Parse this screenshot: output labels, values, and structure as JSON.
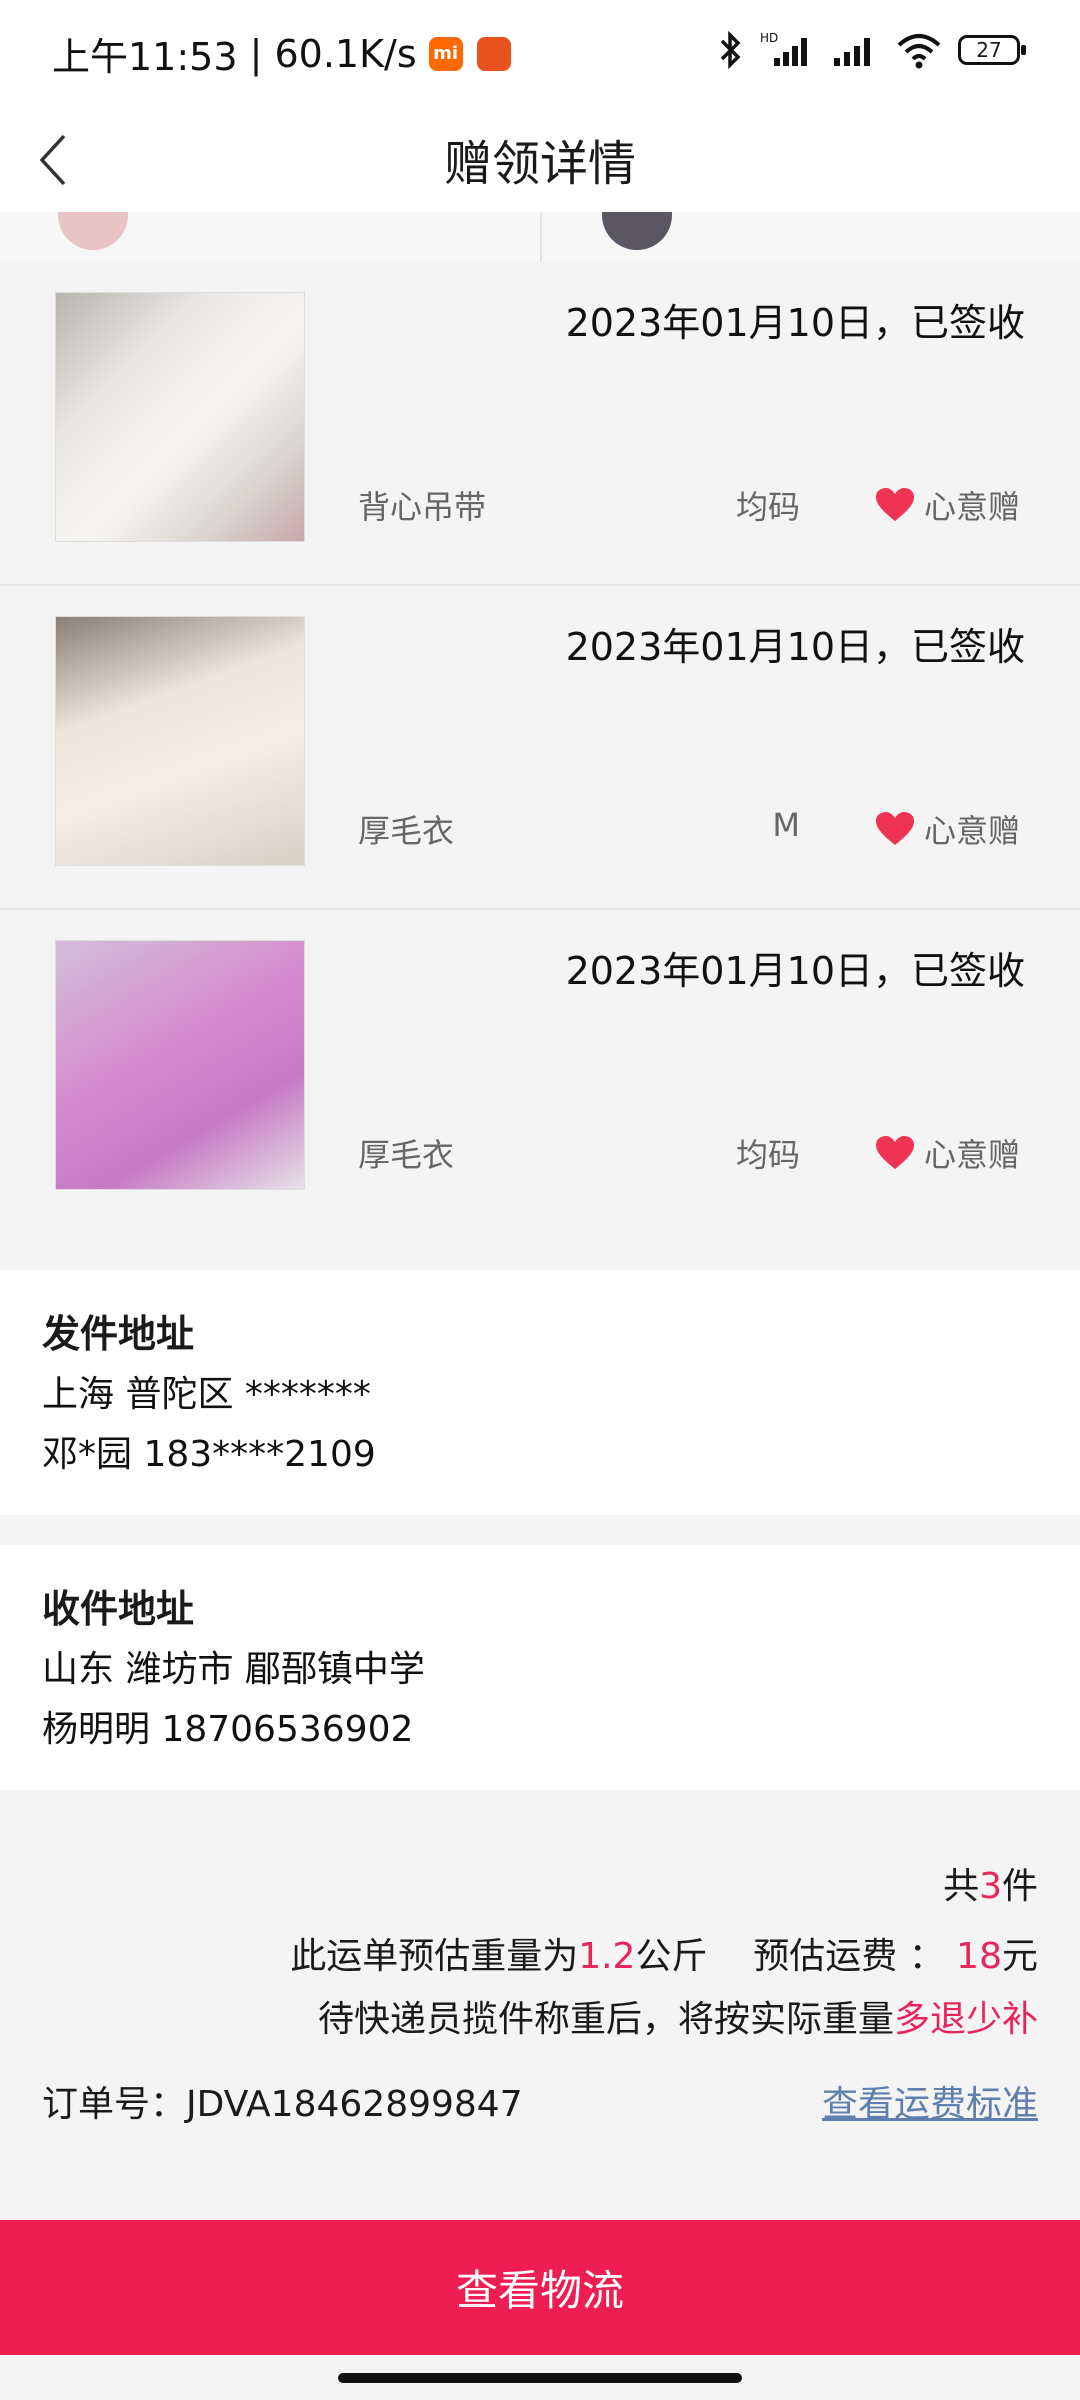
{
  "status": {
    "time": "上午11:53",
    "net_speed": "60.1K/s",
    "mi_badge": "mi",
    "battery": "27"
  },
  "nav": {
    "title": "赠领详情"
  },
  "items": [
    {
      "date_status": "2023年01月10日，已签收",
      "name": "背心吊带",
      "size": "均码",
      "tag": "心意赠"
    },
    {
      "date_status": "2023年01月10日，已签收",
      "name": "厚毛衣",
      "size": "M",
      "tag": "心意赠"
    },
    {
      "date_status": "2023年01月10日，已签收",
      "name": "厚毛衣",
      "size": "均码",
      "tag": "心意赠"
    }
  ],
  "sender": {
    "title": "发件地址",
    "address": "上海 普陀区 *******",
    "contact": "邓*园 183****2109"
  },
  "receiver": {
    "title": "收件地址",
    "address": "山东 潍坊市 郿郚镇中学",
    "contact": "杨明明 18706536902"
  },
  "summary": {
    "count_prefix": "共",
    "count": "3",
    "count_suffix": "件",
    "weight_prefix": "此运单预估重量为",
    "weight": "1.2",
    "weight_unit": "公斤",
    "fee_prefix": "预估运费 ：",
    "fee": "18",
    "fee_unit": "元",
    "note_prefix": "待快递员揽件称重后，将按实际重量",
    "note_highlight": "多退少补",
    "order_label": "订单号：",
    "order_no": "JDVA18462899847",
    "standard_link": "查看运费标准"
  },
  "bottom_button": "查看物流",
  "colors": {
    "accent": "#ee1d52",
    "highlight": "#e8245a",
    "link": "#5f7fae",
    "heart": "#ee3355"
  }
}
